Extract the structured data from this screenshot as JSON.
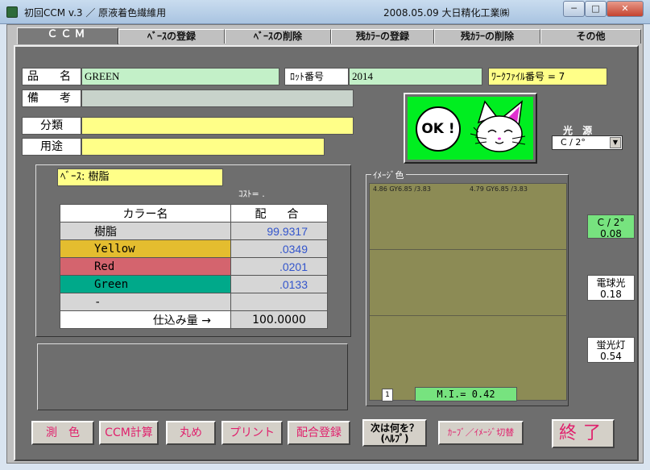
{
  "window": {
    "title_left": "初回CCM  v.3 ／ 原液着色繊維用",
    "title_right": "2008.05.09  大日精化工業㈱",
    "min": "─",
    "max": "□",
    "close": "✕"
  },
  "tabs": [
    "ＣＣＭ",
    "ﾍﾞｰｽの登録",
    "ﾍﾞｰｽの削除",
    "残ｶﾗｰの登録",
    "残ｶﾗｰの削除",
    "その他"
  ],
  "form": {
    "product_label": "品　名",
    "product_value": "GREEN",
    "lot_label": "ﾛｯﾄ番号",
    "lot_value": "2014",
    "workfile": "ﾜｰｸﾌｧｲﾙ番号 = 7",
    "remark_label": "備　考",
    "remark_value": "",
    "category_label": "分類",
    "category_value": "",
    "usage_label": "用途",
    "usage_value": ""
  },
  "status": {
    "ok_text": "OK !"
  },
  "light_source": {
    "label": "光 源",
    "selected": "C / 2°"
  },
  "base": {
    "label": "ﾍﾞｰｽ: 樹脂",
    "cost": "ｺｽﾄ= ."
  },
  "mix_table": {
    "header_name": "カラー名",
    "header_ratio": "配　合",
    "rows": [
      {
        "name": "樹脂",
        "value": "99.9317",
        "color": "#d6d6d6"
      },
      {
        "name": "Yellow",
        "value": ".0349",
        "color": "#e4bd2f"
      },
      {
        "name": "Red",
        "value": ".0201",
        "color": "#d4646e"
      },
      {
        "name": "Green",
        "value": ".0133",
        "color": "#00a98a"
      },
      {
        "name": "-",
        "value": "",
        "color": "#d6d6d6"
      }
    ],
    "total_label": "仕込み量 →",
    "total_value": "100.0000"
  },
  "image_color": {
    "caption": "ｲﾒｰｼﾞ色",
    "left_label": "4.86 GY6.85 /3.83",
    "right_label": "4.79 GY6.85 /3.83",
    "page": "1",
    "mi": "M.I.= 0.42"
  },
  "side_values": [
    {
      "label": "C / 2°",
      "value": "0.08",
      "color": "#77e37f"
    },
    {
      "label": "電球光",
      "value": "0.18",
      "color": "#ffffff"
    },
    {
      "label": "蛍光灯",
      "value": "0.54",
      "color": "#ffffff"
    }
  ],
  "buttons": {
    "measure": "測　色",
    "ccm_calc": "CCM計算",
    "round": "丸め",
    "print": "プリント",
    "register_mix": "配合登録",
    "help_line1": "次は何を？",
    "help_line2": "(ﾍﾙﾌﾟ)",
    "curve_switch": "ｶｰﾌﾞ／ｲﾒｰｼﾞ切替",
    "exit": "終了"
  }
}
